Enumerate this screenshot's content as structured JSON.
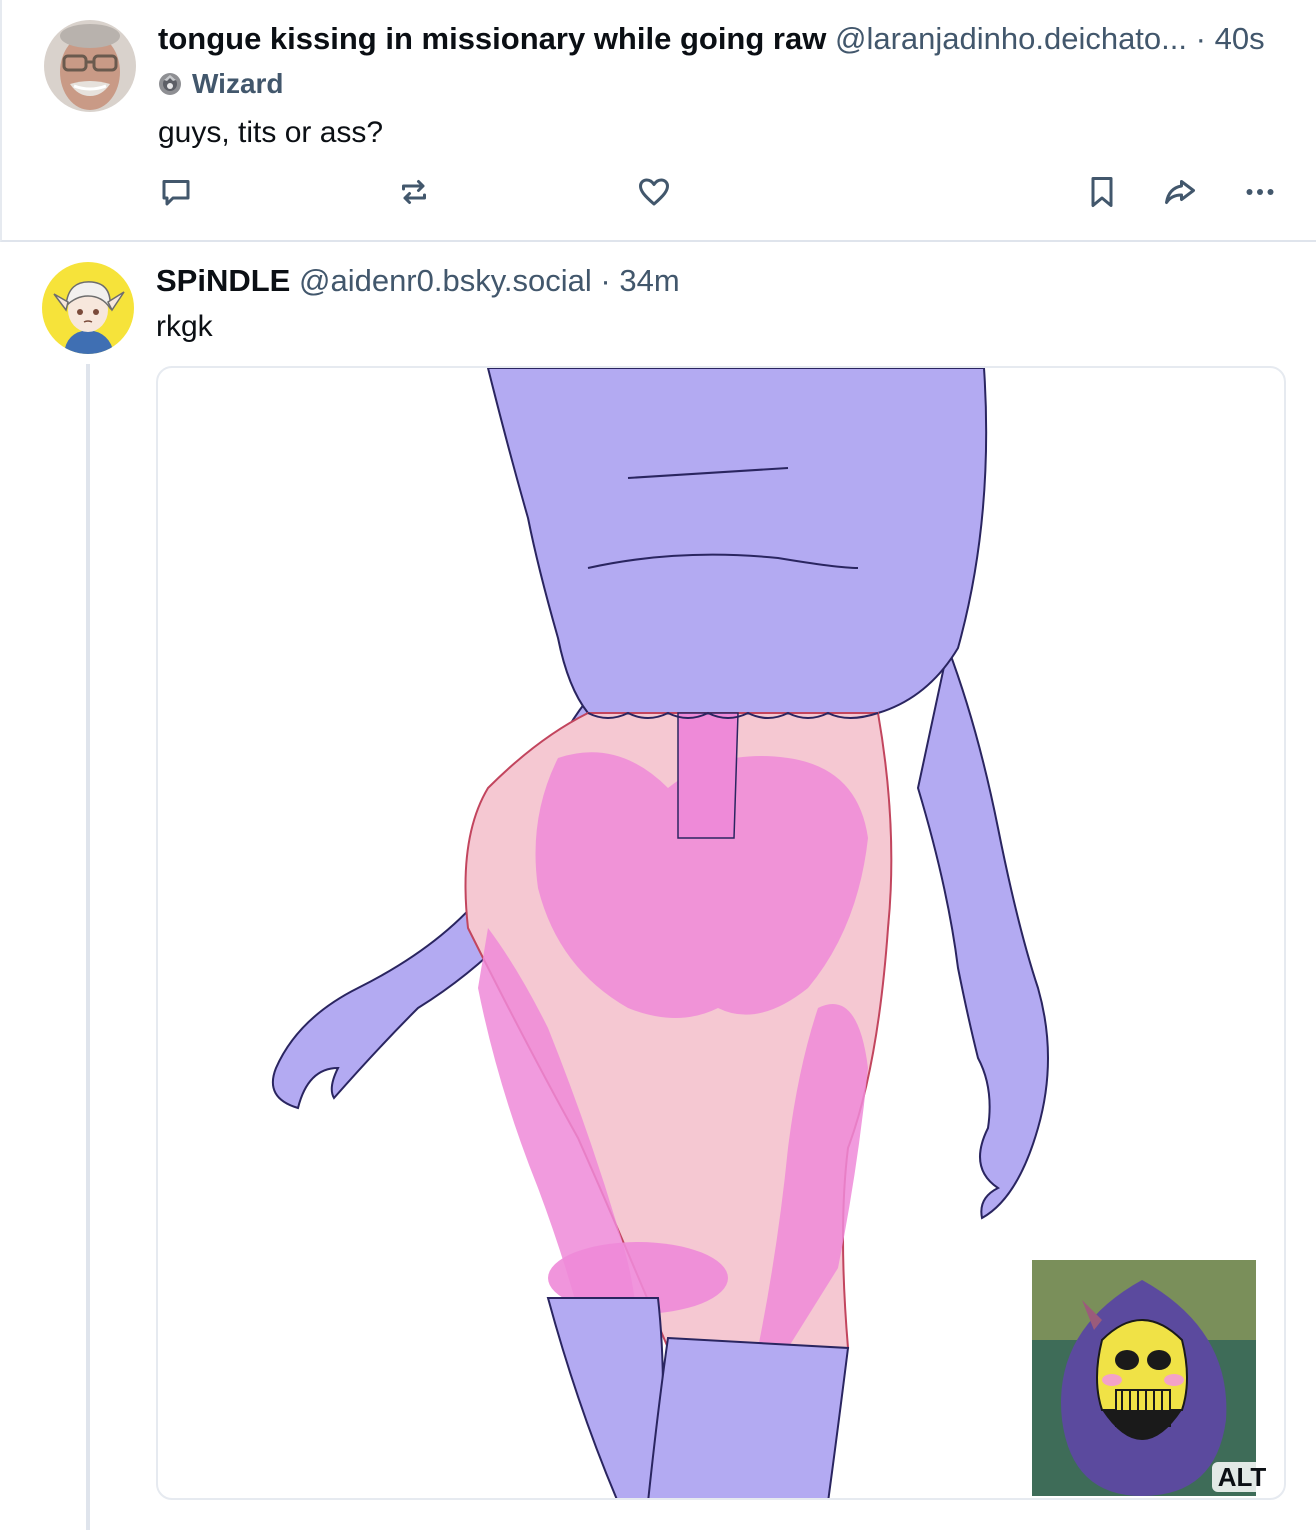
{
  "posts": [
    {
      "display_name": "tongue kissing in missionary while going raw",
      "handle": "@laranjadinho.deichato...",
      "separator": "·",
      "time": "40s",
      "badge": {
        "icon": "wizard-icon",
        "label": "Wizard"
      },
      "text": "guys, tits or ass?",
      "actions": [
        "reply-icon",
        "repost-icon",
        "like-icon",
        "bookmark-icon",
        "share-icon",
        "more-icon"
      ]
    },
    {
      "display_name": "SPiNDLE",
      "handle": "@aidenr0.bsky.social",
      "separator": "·",
      "time": "34m",
      "text": "rkgk",
      "media": {
        "alt_label": "ALT",
        "inset_icon": "skeletor-reaction-image"
      }
    }
  ],
  "colors": {
    "text_primary": "#0b0f14",
    "text_secondary": "#42576c",
    "border": "#dfe4ec",
    "art_purple": "#b3aaf2",
    "art_pink": "#f5c8d2",
    "art_magenta": "#ee8ad8"
  }
}
